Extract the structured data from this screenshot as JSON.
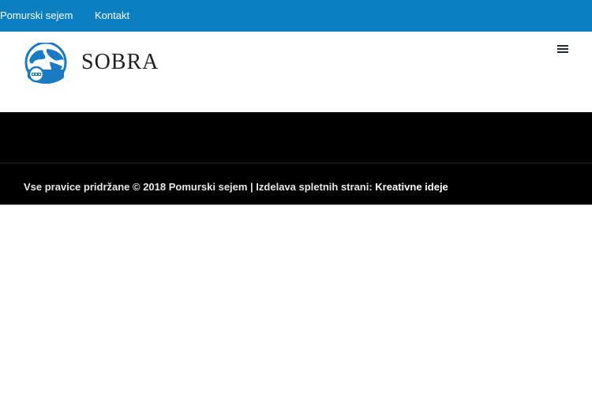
{
  "topbar": {
    "links": [
      "Pomurski sejem",
      "Kontakt"
    ]
  },
  "header": {
    "logo_text": "SOBRA",
    "menu_icon": "hamburger-icon",
    "logo_icon": "globe-icon"
  },
  "footer": {
    "copyright_text": "Vse pravice pridržane © 2018 Pomurski sejem | Izdelava spletnih strani: ",
    "credit_link": "Kreativne ideje"
  },
  "colors": {
    "topbar_bg": "#0b7fc1",
    "logo_blue": "#1a7ac4",
    "dark_band": "#000000",
    "footer_text": "#ffffff"
  }
}
